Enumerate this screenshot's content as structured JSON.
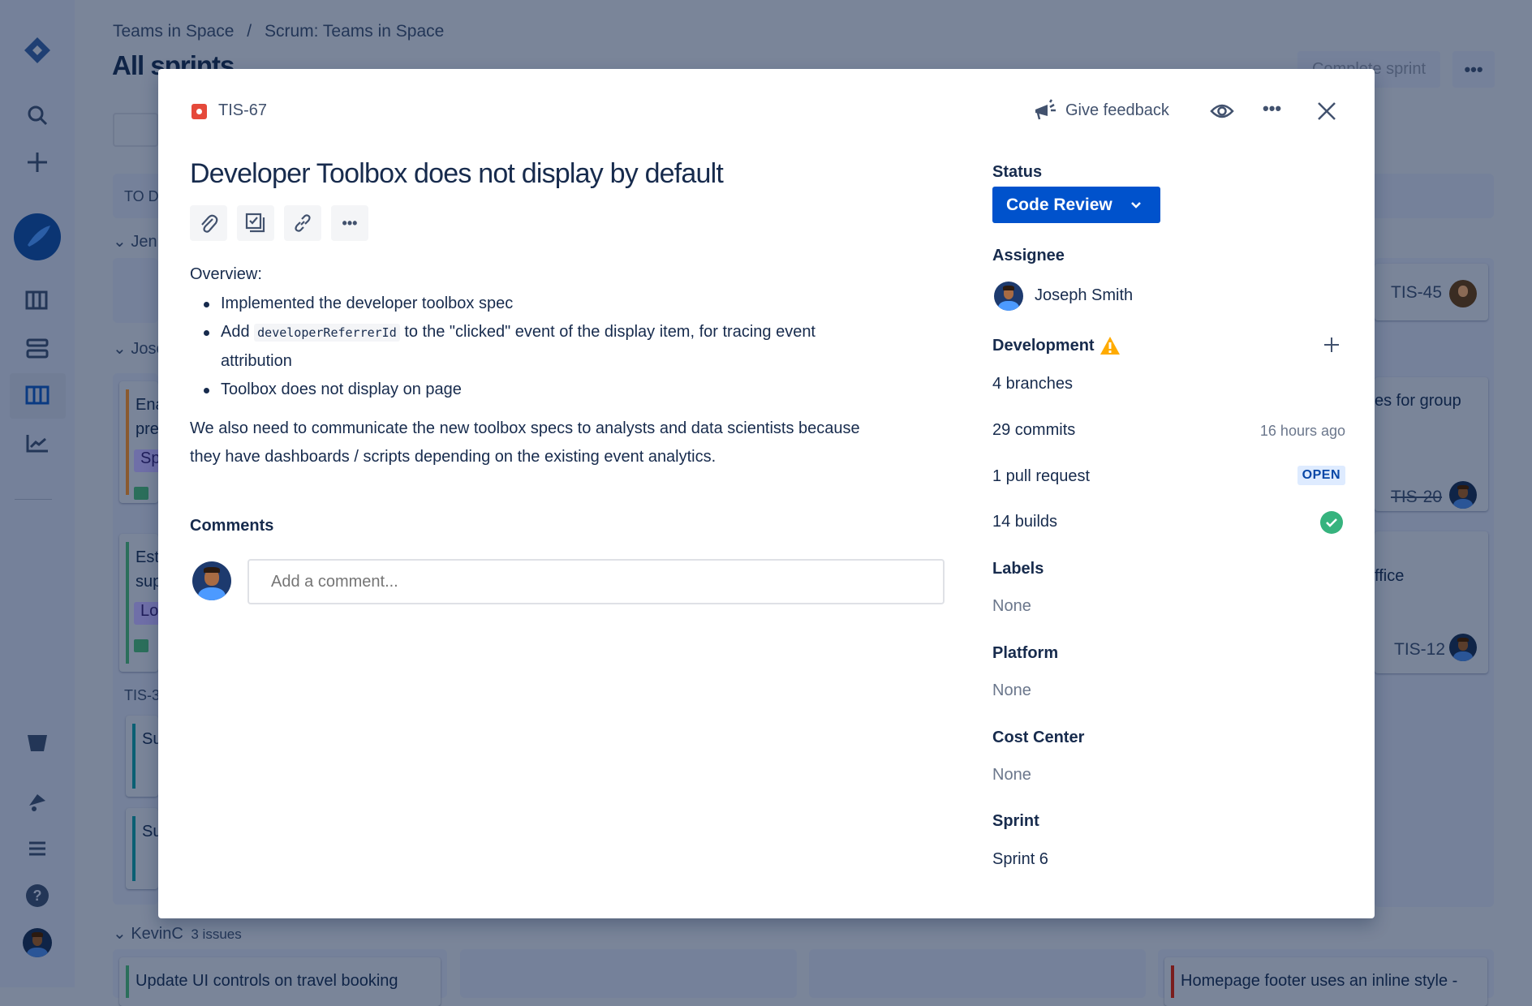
{
  "background": {
    "breadcrumb": [
      "Teams in Space",
      "/",
      "Scrum: Teams in Space"
    ],
    "page_title": "All sprints",
    "complete_sprint_label": "Complete sprint",
    "column_header": "TO D",
    "swimlanes": [
      {
        "name": "Jenn"
      },
      {
        "name": "Jose"
      },
      {
        "name": "KevinC",
        "count": "3 issues"
      }
    ],
    "cards": [
      {
        "text": "Ena",
        "text2": "pre",
        "tag": "Sp"
      },
      {
        "text": "Est",
        "text2": "sup",
        "tag": "Lo"
      },
      {
        "text": "Su"
      },
      {
        "text": "Su"
      },
      {
        "text": "Update UI controls on travel booking"
      },
      {
        "text": "Homepage footer uses an inline style -"
      }
    ],
    "subtask_header": "TIS-3",
    "right_cards": [
      {
        "key": "TIS-45"
      },
      {
        "text": "es for group",
        "key": "TIS-20"
      },
      {
        "text": "ffice",
        "key": "TIS-12"
      }
    ]
  },
  "modal": {
    "issue_key": "TIS-67",
    "issue_type_icon": "bug-icon",
    "issue_type_color": "#e5493a",
    "header": {
      "feedback_label": "Give feedback"
    },
    "title": "Developer Toolbox does not display by default",
    "description": {
      "intro": "Overview:",
      "bullets": [
        {
          "text": "Implemented the developer toolbox spec"
        },
        {
          "before": "Add",
          "code": "developerReferrerId",
          "after": "to the \"clicked\" event of the display item, for tracing event",
          "cont": "attribution"
        },
        {
          "text": "Toolbox does not display on page"
        }
      ],
      "para1": "We also need to communicate the new toolbox specs to analysts and data scientists because",
      "para2": "they have dashboards / scripts depending on the existing event analytics."
    },
    "comments": {
      "heading": "Comments",
      "placeholder": "Add a comment..."
    },
    "fields": {
      "status_label": "Status",
      "status_value": "Code Review",
      "status_color": "#0052cc",
      "assignee_label": "Assignee",
      "assignee_name": "Joseph Smith",
      "development_label": "Development",
      "branches": "4 branches",
      "commits": "29 commits",
      "commits_time": "16 hours ago",
      "pull_requests": "1 pull request",
      "pr_status": "OPEN",
      "builds": "14 builds",
      "builds_status": "success",
      "labels_label": "Labels",
      "labels_value": "None",
      "platform_label": "Platform",
      "platform_value": "None",
      "cost_center_label": "Cost Center",
      "cost_center_value": "None",
      "sprint_label": "Sprint",
      "sprint_value": "Sprint 6"
    }
  }
}
